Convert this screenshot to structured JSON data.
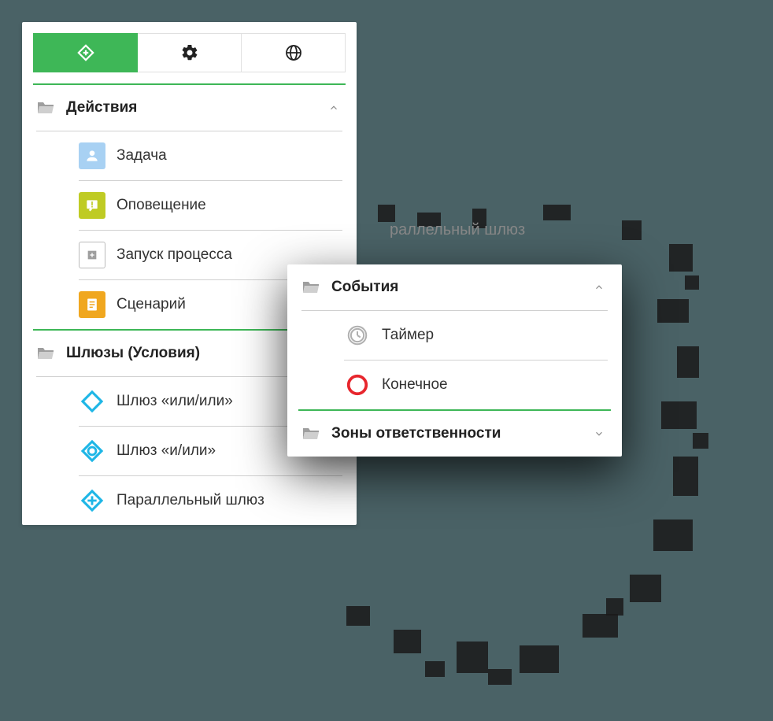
{
  "ghost_label": "раллельный шлюз",
  "panel_left": {
    "tabs": [
      "add",
      "gear",
      "globe"
    ],
    "sections": [
      {
        "title": "Действия",
        "expanded": true,
        "items": [
          {
            "label": "Задача",
            "icon": "task"
          },
          {
            "label": "Оповещение",
            "icon": "notify"
          },
          {
            "label": "Запуск процесса",
            "icon": "process"
          },
          {
            "label": "Сценарий",
            "icon": "script"
          }
        ]
      },
      {
        "title": "Шлюзы (Условия)",
        "expanded": true,
        "items": [
          {
            "label": "Шлюз «или/или»",
            "icon": "gw-or"
          },
          {
            "label": "Шлюз «и/или»",
            "icon": "gw-andor"
          },
          {
            "label": "Параллельный шлюз",
            "icon": "gw-parallel"
          }
        ]
      }
    ]
  },
  "panel_right": {
    "sections": [
      {
        "title": "События",
        "expanded": true,
        "items": [
          {
            "label": "Таймер",
            "icon": "timer"
          },
          {
            "label": "Конечное",
            "icon": "end"
          }
        ]
      },
      {
        "title": "Зоны ответственности",
        "expanded": false,
        "items": []
      }
    ]
  },
  "colors": {
    "accent": "#3EB757",
    "cyan": "#1EB6E6",
    "orange": "#F0A71F",
    "olive": "#BFCB24",
    "red": "#E7262D",
    "blue": "#A8D1F3",
    "gray": "#9E9E9E"
  }
}
